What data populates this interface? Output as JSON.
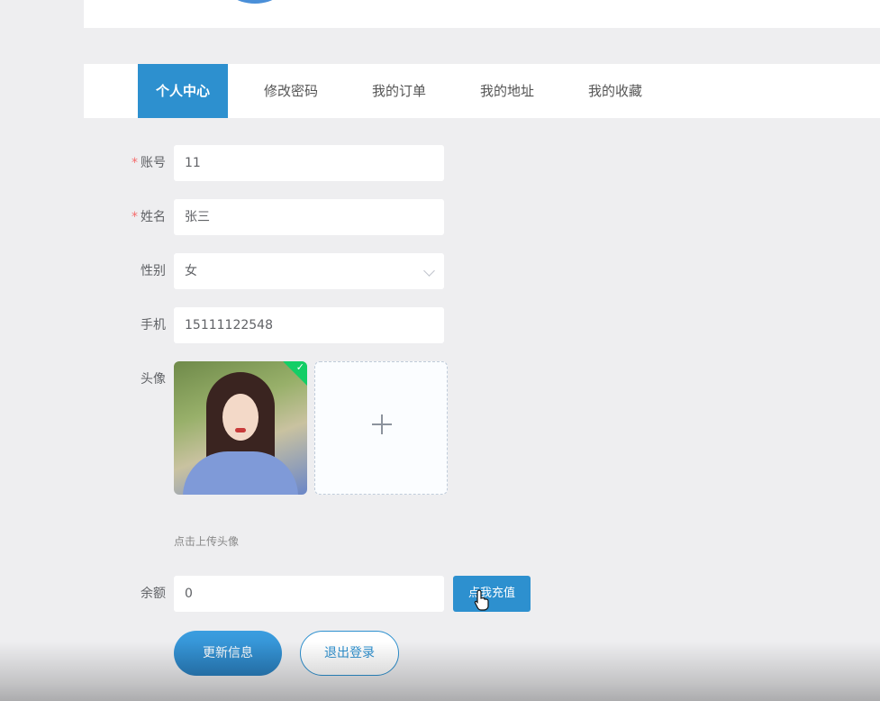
{
  "tabs": [
    {
      "label": "个人中心",
      "active": true
    },
    {
      "label": "修改密码",
      "active": false
    },
    {
      "label": "我的订单",
      "active": false
    },
    {
      "label": "我的地址",
      "active": false
    },
    {
      "label": "我的收藏",
      "active": false
    }
  ],
  "form": {
    "account": {
      "label": "账号",
      "required": "*",
      "value": "11"
    },
    "name": {
      "label": "姓名",
      "required": "*",
      "value": "张三"
    },
    "gender": {
      "label": "性别",
      "value": "女"
    },
    "phone": {
      "label": "手机",
      "value": "15111122548"
    },
    "avatar": {
      "label": "头像",
      "hint": "点击上传头像",
      "check": "✓"
    },
    "balance": {
      "label": "余额",
      "value": "0"
    }
  },
  "buttons": {
    "recharge": "点我充值",
    "update": "更新信息",
    "logout": "退出登录"
  },
  "colors": {
    "accent": "#2d90cf",
    "required": "#f56c6c",
    "success": "#13ce66"
  }
}
